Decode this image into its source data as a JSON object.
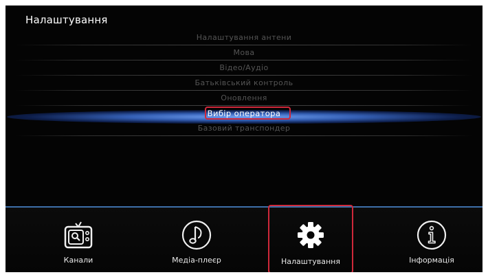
{
  "screen": {
    "title": "Налаштування"
  },
  "menu": {
    "items": [
      {
        "label": "Налаштування антени",
        "selected": false
      },
      {
        "label": "Мова",
        "selected": false
      },
      {
        "label": "Відео/Аудіо",
        "selected": false
      },
      {
        "label": "Батьківський контроль",
        "selected": false
      },
      {
        "label": "Оновлення",
        "selected": false
      },
      {
        "label": "Вибір оператора",
        "selected": true
      },
      {
        "label": "Базовий транспондер",
        "selected": false
      }
    ]
  },
  "bottom_nav": {
    "items": [
      {
        "label": "Канали",
        "icon": "tv-search-icon",
        "active": false
      },
      {
        "label": "Медіа-плеєр",
        "icon": "music-note-icon",
        "active": false
      },
      {
        "label": "Налаштування",
        "icon": "gear-icon",
        "active": true
      },
      {
        "label": "Інформація",
        "icon": "info-icon",
        "active": false
      }
    ]
  },
  "colors": {
    "background": "#040404",
    "highlight_border": "#d0283a",
    "selection_glow": "#4a7fe0",
    "divider": "#3d6fa8",
    "inactive_text": "#555555",
    "active_text": "#ffffff"
  }
}
